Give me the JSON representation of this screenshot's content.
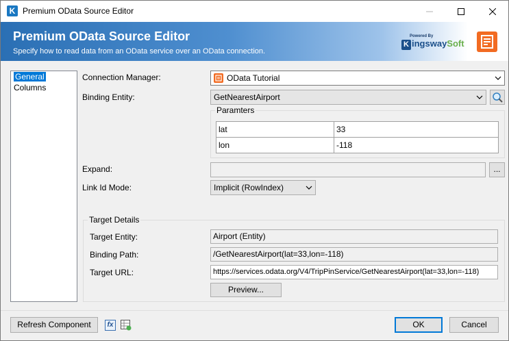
{
  "window": {
    "title": "Premium OData Source Editor",
    "controls": {
      "minimize": "minimize",
      "maximize": "maximize",
      "close": "close"
    }
  },
  "banner": {
    "title": "Premium OData Source Editor",
    "subtitle": "Specify how to read data from an OData service over an OData connection.",
    "logo_powered": "Powered By",
    "logo_k": "K",
    "logo_ingsway": "ingsway",
    "logo_soft": "Soft",
    "brand_color": "#1b4f8a",
    "accent_color": "#f26b22"
  },
  "nav": {
    "items": [
      {
        "label": "General",
        "selected": true
      },
      {
        "label": "Columns",
        "selected": false
      }
    ]
  },
  "form": {
    "connection_manager_label": "Connection Manager:",
    "connection_manager_value": "OData Tutorial",
    "binding_entity_label": "Binding Entity:",
    "binding_entity_value": "GetNearestAirport",
    "parameters_title": "Paramters",
    "parameters": [
      {
        "name": "lat",
        "value": "33"
      },
      {
        "name": "lon",
        "value": "-118"
      }
    ],
    "expand_label": "Expand:",
    "expand_value": "",
    "expand_button": "...",
    "link_id_mode_label": "Link Id Mode:",
    "link_id_mode_value": "Implicit (RowIndex)"
  },
  "target": {
    "title": "Target Details",
    "entity_label": "Target Entity:",
    "entity_value": "Airport (Entity)",
    "binding_path_label": "Binding Path:",
    "binding_path_value": "/GetNearestAirport(lat=33,lon=-118)",
    "url_label": "Target URL:",
    "url_value": "https://services.odata.org/V4/TripPinService/GetNearestAirport(lat=33,lon=-118)",
    "preview_button": "Preview..."
  },
  "footer": {
    "refresh_button": "Refresh Component",
    "fx_icon": "fx",
    "ok_button": "OK",
    "cancel_button": "Cancel"
  }
}
